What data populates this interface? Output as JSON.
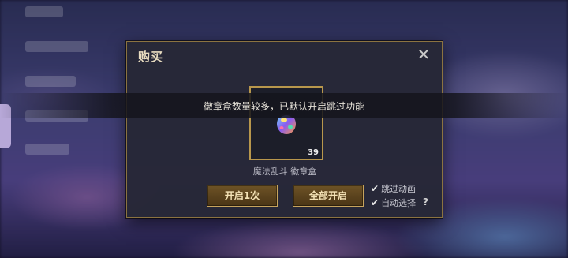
{
  "modal": {
    "title": "购买",
    "close_symbol": "✕"
  },
  "item": {
    "name": "魔法乱斗 徽章盒",
    "count": "39",
    "icon": "badge-box-icon"
  },
  "toast": {
    "message": "徽章盒数量较多，已默认开启跳过功能"
  },
  "buttons": {
    "open_once": "开启1次",
    "open_all": "全部开启"
  },
  "options": {
    "skip_animation": {
      "label": "跳过动画",
      "checked": true
    },
    "auto_select": {
      "label": "自动选择",
      "checked": true
    },
    "help_symbol": "?"
  },
  "colors": {
    "gold_border": "#b8974c",
    "modal_bg": "#26283a",
    "button_bg": "#5c4320",
    "button_text": "#f4e2b6"
  }
}
